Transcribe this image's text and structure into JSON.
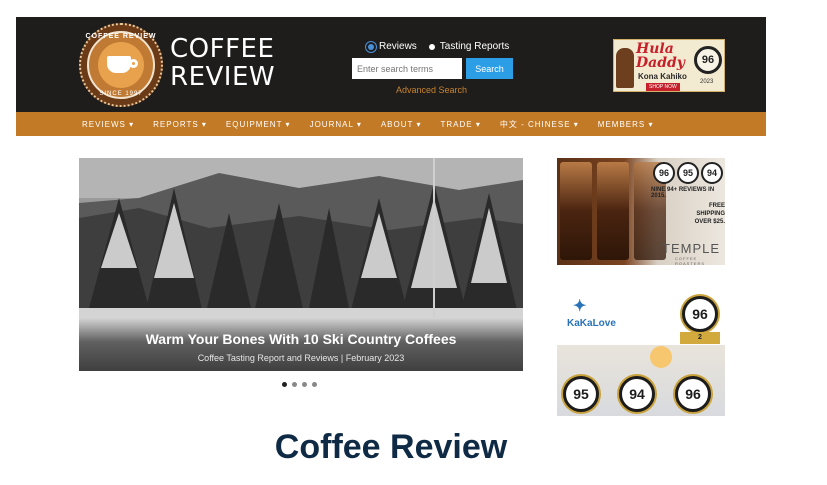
{
  "header": {
    "logo_arc_top": "COFFEE REVIEW",
    "logo_arc_bottom": "SINCE 1997",
    "wordmark_line1": "COFFEE",
    "wordmark_line2": "REVIEW",
    "search": {
      "option_reviews": "Reviews",
      "option_tasting": "Tasting Reports",
      "selected": "Reviews",
      "placeholder": "Enter search terms",
      "button_label": "Search",
      "advanced_link": "Advanced Search"
    },
    "ad": {
      "title_line1": "Hula",
      "title_line2": "Daddy",
      "subtitle": "Kona Kahiko",
      "shop": "SHOP NOW",
      "score": "96",
      "year": "2023"
    }
  },
  "nav": {
    "items": [
      {
        "label": "REVIEWS ▾"
      },
      {
        "label": "REPORTS ▾"
      },
      {
        "label": "EQUIPMENT ▾"
      },
      {
        "label": "JOURNAL ▾"
      },
      {
        "label": "ABOUT ▾"
      },
      {
        "label": "TRADE ▾"
      },
      {
        "label": "中文 - CHINESE ▾"
      },
      {
        "label": "MEMBERS ▾"
      }
    ]
  },
  "hero": {
    "title": "Warm Your Bones With 10 Ski Country Coffees",
    "subtitle": "Coffee Tasting Report and Reviews | February 2023",
    "slide_count": 4,
    "active_slide": 1
  },
  "side_ads": {
    "temple": {
      "scores": [
        "96",
        "95",
        "94"
      ],
      "line1": "NINE 94+ REVIEWS IN 2015.",
      "line2a": "FREE SHIPPING",
      "line2b": "OVER $25.",
      "brand": "TEMPLE",
      "brand_sub": "COFFEE ROASTERS"
    },
    "kakalove": {
      "logo_text": "KaKaLove",
      "scores": [
        "96",
        "95",
        "94",
        "96"
      ],
      "ribbon": "2"
    }
  },
  "page_title": "Coffee Review",
  "colors": {
    "header_bg": "#1e1d1c",
    "nav_bg": "#c27a26",
    "accent_blue": "#2c9ee6",
    "title_navy": "#0f2a45"
  }
}
